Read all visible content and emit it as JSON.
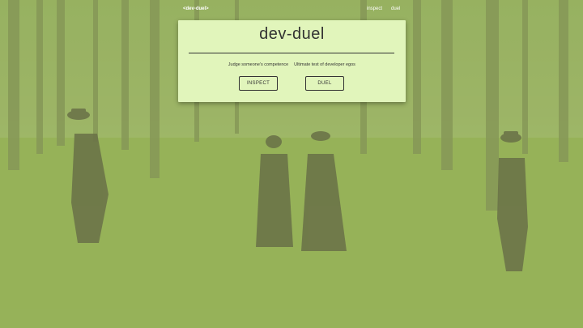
{
  "navbar": {
    "brand": "<dev-duel>",
    "links": [
      {
        "label": "inspect"
      },
      {
        "label": "duel"
      }
    ]
  },
  "card": {
    "title": "dev-duel",
    "options": [
      {
        "description": "Judge someone's competence",
        "button_label": "INSPECT"
      },
      {
        "description": "Ultimate test of developer egos",
        "button_label": "DUEL"
      }
    ]
  },
  "colors": {
    "card_background": "#e1f5bb",
    "overlay_tint": "#b7cf78",
    "text": "#333333",
    "nav_text": "#ffffff"
  },
  "background": {
    "description_icon": "forest-photo"
  }
}
